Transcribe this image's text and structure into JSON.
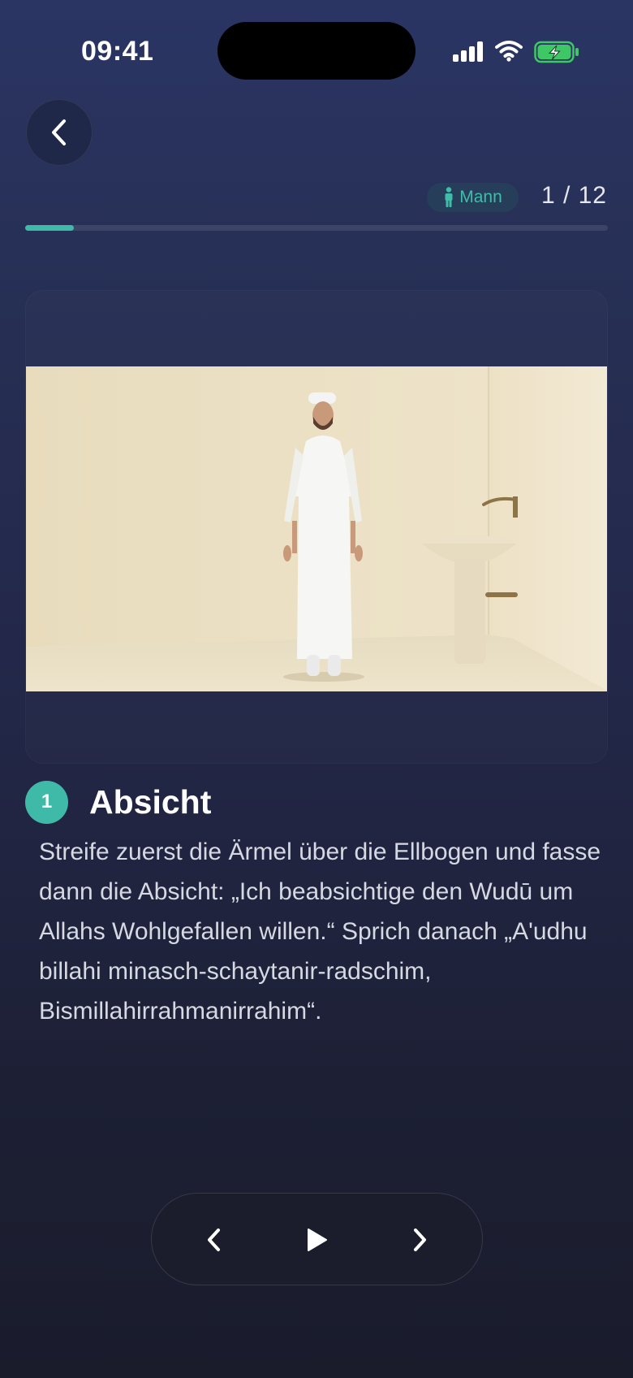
{
  "status_bar": {
    "time": "09:41"
  },
  "header": {
    "back_icon": "chevron-left-icon",
    "gender_badge": {
      "icon": "person-icon",
      "label": "Mann"
    },
    "counter": "1 / 12",
    "progress": 0.083
  },
  "step": {
    "number": "1",
    "title": "Absicht",
    "description": "Streife zuerst die Ärmel über die Ellbogen und fasse dann die Absicht: „Ich beabsichtige den Wudū um Allahs Wohlgefallen willen.“ Sprich danach „A'udhu billahi minasch-schaytanir-radschim, Bismillahirrahmanirrahim“."
  },
  "player": {
    "prev_icon": "chevron-left-icon",
    "play_icon": "play-icon",
    "next_icon": "chevron-right-icon"
  },
  "colors": {
    "accent": "#3fbaa8",
    "background_top": "#2b3564",
    "background_bottom": "#1a1c2c"
  }
}
